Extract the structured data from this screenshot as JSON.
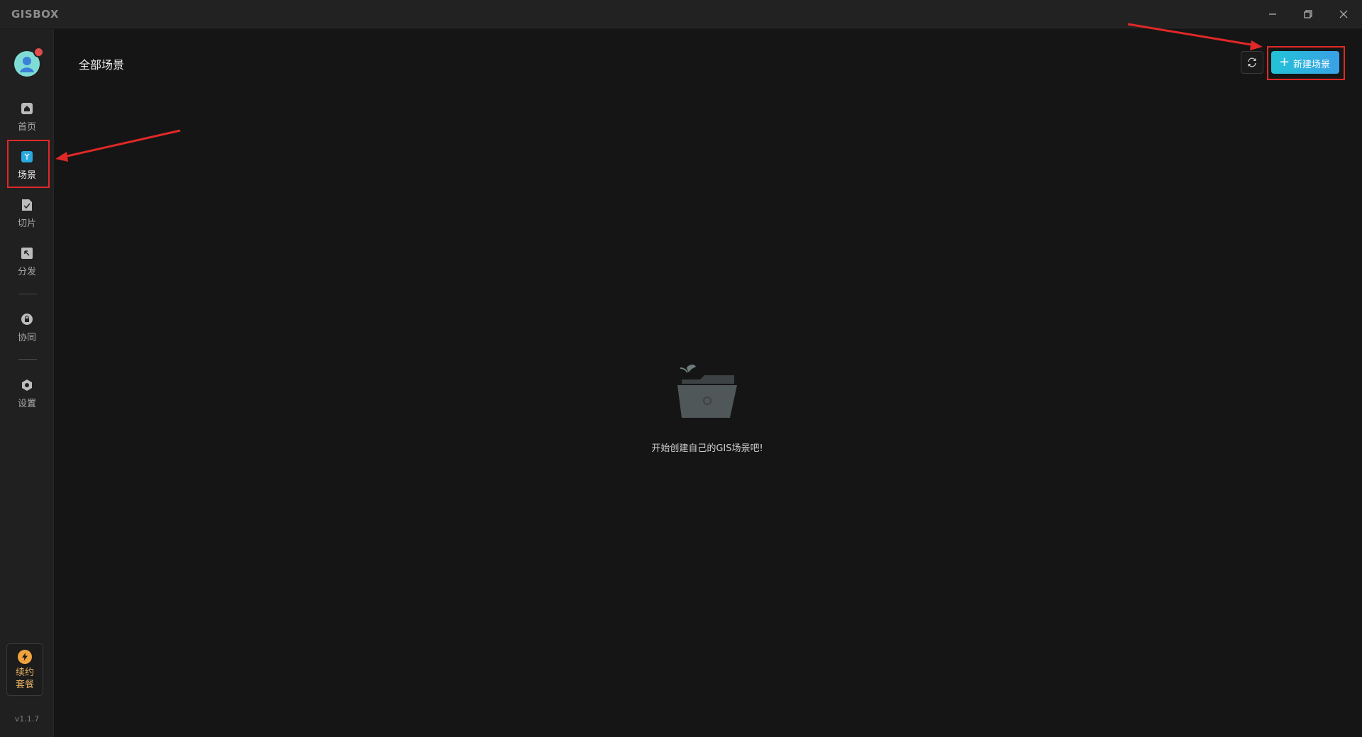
{
  "app": {
    "logo": "GISBOX"
  },
  "window_controls": {
    "minimize": "minimize-icon",
    "maximize": "restore-icon",
    "close": "close-icon"
  },
  "sidebar": {
    "avatar": "user-avatar",
    "items": [
      {
        "label": "首页",
        "icon": "home-icon",
        "active": false
      },
      {
        "label": "场景",
        "icon": "cube-icon",
        "active": true
      },
      {
        "label": "切片",
        "icon": "slice-icon",
        "active": false
      },
      {
        "label": "分发",
        "icon": "distribute-icon",
        "active": false
      },
      {
        "label": "协同",
        "icon": "lock-icon",
        "active": false
      },
      {
        "label": "设置",
        "icon": "settings-icon",
        "active": false
      }
    ],
    "renew": {
      "line1": "续约",
      "line2": "套餐",
      "icon": "lightning-icon"
    },
    "version": "v1.1.7"
  },
  "main": {
    "title": "全部场景",
    "refresh_icon": "refresh-icon",
    "new_scene_label": "新建场景",
    "empty_text": "开始创建自己的GIS场景吧!"
  },
  "colors": {
    "accent": "#22c3d6",
    "accent2": "#3aa0e6",
    "annotation": "#e02828",
    "renew": "#f0a33c",
    "badge": "#e24b4b"
  }
}
